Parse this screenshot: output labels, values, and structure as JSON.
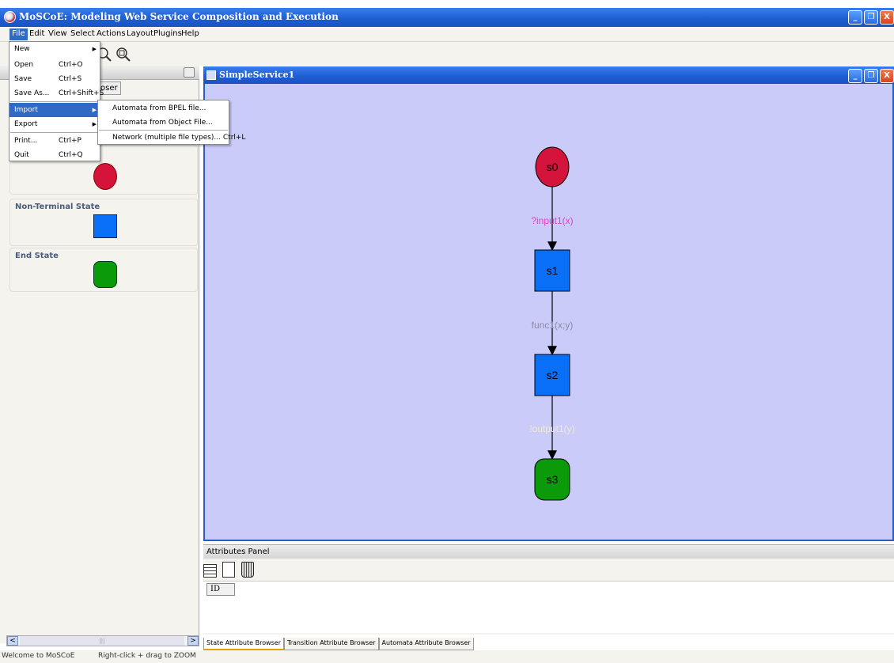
{
  "window": {
    "title": "MoSCoE: Modeling Web Service Composition and Execution",
    "controls": [
      "_",
      "❐",
      "X"
    ]
  },
  "menubar": [
    "File",
    "Edit",
    "View",
    "Select",
    "Actions",
    "Layout",
    "Plugins",
    "Help"
  ],
  "file_menu": {
    "items": [
      {
        "label": "New",
        "shortcut": ""
      },
      {
        "label": "Open",
        "shortcut": "Ctrl+O"
      },
      {
        "label": "Save",
        "shortcut": "Ctrl+S"
      },
      {
        "label": "Save As...",
        "shortcut": "Ctrl+Shift+S"
      },
      {
        "label": "Import",
        "shortcut": ""
      },
      {
        "label": "Export",
        "shortcut": ""
      },
      {
        "label": "Print...",
        "shortcut": "Ctrl+P"
      },
      {
        "label": "Quit",
        "shortcut": "Ctrl+Q"
      }
    ]
  },
  "import_submenu": {
    "items": [
      {
        "label": "Automata from BPEL file..."
      },
      {
        "label": "Automata from Object File..."
      },
      {
        "label": "Network (multiple file types)... Ctrl+L"
      }
    ]
  },
  "left_panel": {
    "tab_stub": "oser",
    "palette": [
      {
        "label": "",
        "shape": "circle",
        "color": "#d4143a"
      },
      {
        "label": "Non-Terminal State",
        "shape": "square",
        "color": "#0a6ff7"
      },
      {
        "label": "End State",
        "shape": "rounded",
        "color": "#0a9a0a"
      }
    ]
  },
  "frame": {
    "title": "SimpleService1"
  },
  "graph": {
    "nodes": [
      {
        "id": "s0",
        "shape": "circle",
        "color": "#d4143a"
      },
      {
        "id": "s1",
        "shape": "square",
        "color": "#0a6ff7"
      },
      {
        "id": "s2",
        "shape": "square",
        "color": "#0a6ff7"
      },
      {
        "id": "s3",
        "shape": "rounded",
        "color": "#0a9a0a"
      }
    ],
    "edges": [
      {
        "from": "s0",
        "to": "s1",
        "label": "?input1(x)",
        "color": "#e040c8"
      },
      {
        "from": "s1",
        "to": "s2",
        "label": "func1(x;y)",
        "color": "#8a8aa8"
      },
      {
        "from": "s2",
        "to": "s3",
        "label": "!output1(y)",
        "color": "#e6e0c0"
      }
    ],
    "canvas_color": "#cbcbf9"
  },
  "attributes": {
    "title": "Attributes Panel",
    "column": "ID",
    "tabs": [
      "State Attribute Browser",
      "Transition Attribute Browser",
      "Automata Attribute Browser"
    ]
  },
  "status": {
    "left": "Welcome to MoSCoE",
    "right": "Right-click + drag to ZOOM"
  }
}
